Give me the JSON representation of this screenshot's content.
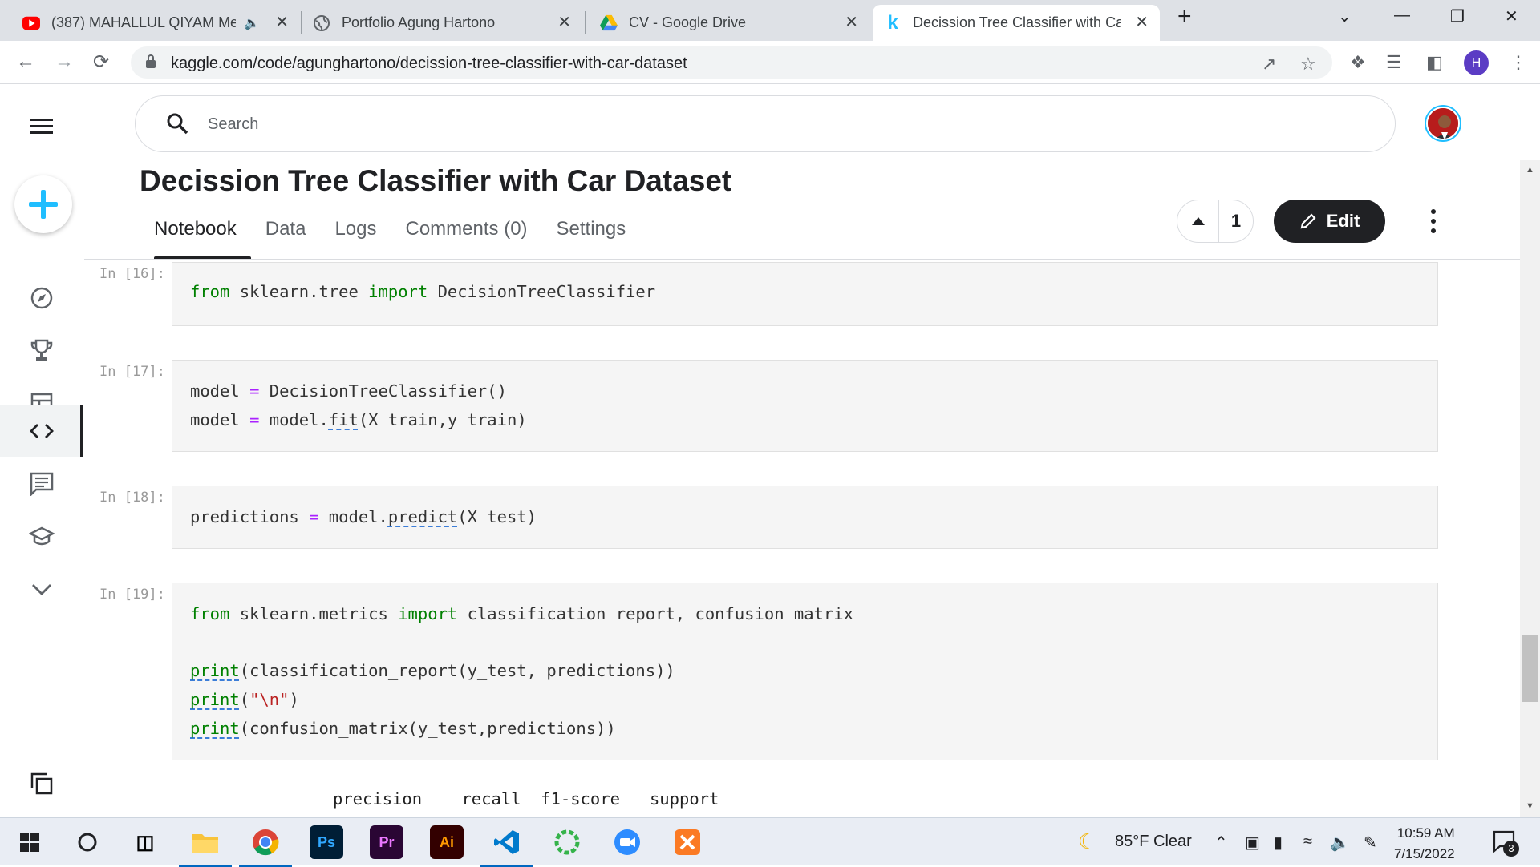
{
  "browser": {
    "tabs": [
      {
        "title": "(387) MAHALLUL QIYAM Me",
        "icon": "youtube-icon",
        "audio": true
      },
      {
        "title": "Portfolio Agung Hartono",
        "icon": "globe-icon"
      },
      {
        "title": "CV - Google Drive",
        "icon": "google-drive-icon"
      },
      {
        "title": "Decission Tree Classifier with Car",
        "icon": "kaggle-icon",
        "active": true
      }
    ],
    "url": "kaggle.com/code/agunghartono/decission-tree-classifier-with-car-dataset",
    "profile_initial": "H"
  },
  "kaggle": {
    "search_placeholder": "Search",
    "title": "Decission Tree Classifier with Car Dataset",
    "tabs": [
      "Notebook",
      "Data",
      "Logs",
      "Comments (0)",
      "Settings"
    ],
    "active_tab": "Notebook",
    "vote_count": "1",
    "edit_label": "Edit",
    "nav_icons": [
      "compass-icon",
      "trophy-icon",
      "table-icon",
      "code-icon",
      "comments-icon",
      "school-icon",
      "chevron-down-icon",
      "copy-icon"
    ],
    "brand_color": "#20beff"
  },
  "notebook": {
    "cells": [
      {
        "prompt": "In [16]:",
        "lines": [
          "from sklearn.tree import DecisionTreeClassifier"
        ]
      },
      {
        "prompt": "In [17]:",
        "lines": [
          "model = DecisionTreeClassifier()",
          "model = model.fit(X_train,y_train)"
        ]
      },
      {
        "prompt": "In [18]:",
        "lines": [
          "predictions = model.predict(X_test)"
        ]
      },
      {
        "prompt": "In [19]:",
        "lines": [
          "from sklearn.metrics import classification_report, confusion_matrix",
          "",
          "print(classification_report(y_test, predictions))",
          "print(\"\\n\")",
          "print(confusion_matrix(y_test,predictions))"
        ]
      }
    ],
    "output_header": "precision    recall  f1-score   support"
  },
  "taskbar": {
    "weather": "85°F  Clear",
    "time": "10:59 AM",
    "date": "7/15/2022",
    "notification_count": "3",
    "apps": [
      "windows-start-icon",
      "search-icon",
      "task-view-icon",
      "file-explorer-icon",
      "chrome-icon",
      "photoshop-icon",
      "premiere-icon",
      "illustrator-icon",
      "vscode-icon",
      "app-ring-icon",
      "zoom-icon",
      "xampp-icon"
    ]
  }
}
